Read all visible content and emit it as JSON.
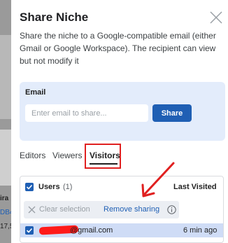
{
  "background": {
    "text_line1": "ira",
    "text_line2": "DB4",
    "text_line3": "17,5"
  },
  "dialog": {
    "title": "Share Niche",
    "description": "Share the niche to a Google-compatible email (either Gmail or Google Workspace). The recipient can view but not modify it",
    "close_icon": "close-icon"
  },
  "email_section": {
    "label": "Email",
    "placeholder": "Enter email to share...",
    "value": "",
    "share_label": "Share"
  },
  "tabs": [
    {
      "label": "Editors",
      "active": false
    },
    {
      "label": "Viewers",
      "active": false
    },
    {
      "label": "Visitors",
      "active": true
    }
  ],
  "list": {
    "header_label": "Users",
    "header_count": "(1)",
    "column_label": "Last Visited",
    "toolbar": {
      "clear_label": "Clear selection",
      "remove_label": "Remove sharing"
    },
    "rows": [
      {
        "email": "@gmail.com",
        "last_visited": "6 min ago",
        "selected": true
      }
    ]
  },
  "colors": {
    "accent": "#1f5fb4",
    "email_panel": "#e3ecfb",
    "selected_row": "#cfdcf6",
    "annotation": "#e02020"
  }
}
